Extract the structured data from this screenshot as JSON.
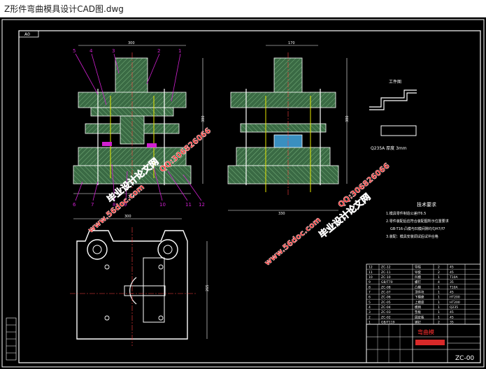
{
  "window": {
    "title": "Z形件弯曲模具设计CAD图.dwg"
  },
  "drawing": {
    "sheet_size_label": "A0",
    "dims": {
      "front_width": "300",
      "side_width": "170",
      "height_left": "380",
      "height_right": "380",
      "plan_width": "300",
      "plan_height": "265",
      "bottom_width_left": "350",
      "bottom_width_right": "330"
    },
    "part_numbers_top": [
      "5",
      "4",
      "3",
      "2",
      "1"
    ],
    "part_numbers_bottom": [
      "6",
      "7",
      "8",
      "9",
      "10",
      "11",
      "12"
    ],
    "workpiece_title": "工件图",
    "material_label": "Q235A  厚度 3mm",
    "tech_req_title": "技术要求",
    "tech_req_items": [
      "1.模具零件制造公差IT6.5",
      "2.零件装配后应符合装配图所示位置要求",
      "GB-T16-凸模与凹模间隙均匀H7/f7",
      "3.装配：模具安装调试后试冲合格"
    ],
    "watermarks": [
      "毕业设计论文网",
      "www.56doc.com",
      "QQ:306826066"
    ],
    "title_block": {
      "drawing_name": "弯曲模",
      "drawing_code": "ZC-00"
    },
    "bom_rows": [
      [
        "12",
        "ZC-12",
        "导柱",
        "2",
        "45"
      ],
      [
        "11",
        "ZC-11",
        "导套",
        "2",
        "45"
      ],
      [
        "10",
        "ZC-10",
        "凹模",
        "1",
        "T10A"
      ],
      [
        "9",
        "GB/T70",
        "螺钉",
        "4",
        "35"
      ],
      [
        "8",
        "ZC-08",
        "凸模",
        "1",
        "T10A"
      ],
      [
        "7",
        "ZC-07",
        "顶件块",
        "1",
        "45"
      ],
      [
        "6",
        "ZC-06",
        "下模座",
        "1",
        "HT200"
      ],
      [
        "5",
        "ZC-05",
        "上模座",
        "1",
        "HT200"
      ],
      [
        "4",
        "ZC-04",
        "模柄",
        "1",
        "Q235"
      ],
      [
        "3",
        "ZC-03",
        "垫板",
        "1",
        "45"
      ],
      [
        "2",
        "ZC-02",
        "固定板",
        "1",
        "45"
      ],
      [
        "1",
        "GB/T119",
        "销钉",
        "2",
        "35"
      ]
    ]
  }
}
